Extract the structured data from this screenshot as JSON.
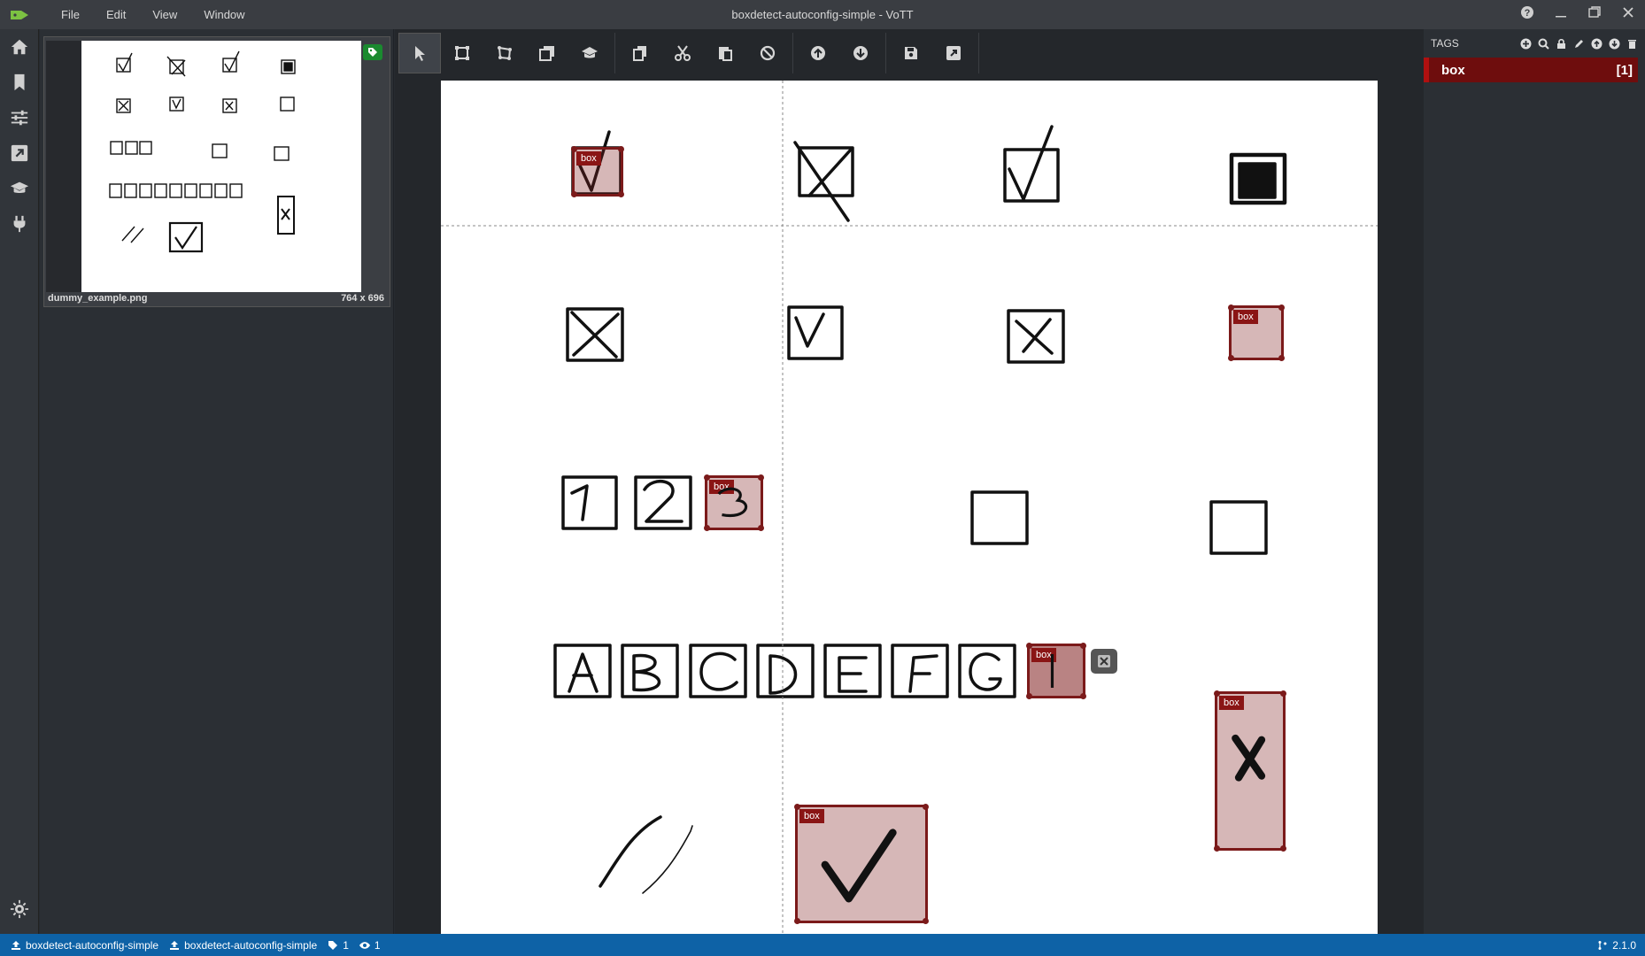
{
  "titlebar": {
    "title": "boxdetect-autoconfig-simple - VoTT",
    "menu": [
      "File",
      "Edit",
      "View",
      "Window"
    ],
    "controls": [
      "help-icon",
      "minimize-icon",
      "restore-icon",
      "close-icon"
    ]
  },
  "leftnav": {
    "items": [
      "home-icon",
      "bookmark-icon",
      "settings-sliders-icon",
      "export-icon",
      "graduation-cap-icon",
      "plug-icon"
    ],
    "settings": "gear-icon"
  },
  "thumbnail": {
    "filename": "dummy_example.png",
    "size": "764 x 696"
  },
  "toolbar": {
    "groups": [
      [
        "select-icon",
        "rectangle-icon",
        "polygon-icon",
        "copy-rectangle-icon",
        "active-learning-icon"
      ],
      [
        "copy-icon",
        "cut-icon",
        "paste-icon",
        "clear-icon"
      ],
      [
        "previous-icon",
        "next-icon"
      ],
      [
        "save-icon",
        "export-icon"
      ]
    ]
  },
  "regions": [
    {
      "label": "box"
    },
    {
      "label": "box"
    },
    {
      "label": "box"
    },
    {
      "label": "box"
    },
    {
      "label": "box"
    },
    {
      "label": "box"
    }
  ],
  "tags": {
    "header": "TAGS",
    "items": [
      {
        "name": "box",
        "count": "[1]"
      }
    ]
  },
  "statusbar": {
    "source": "boxdetect-autoconfig-simple",
    "target": "boxdetect-autoconfig-simple",
    "tag_count": "1",
    "visited_count": "1",
    "version": "2.1.0"
  }
}
